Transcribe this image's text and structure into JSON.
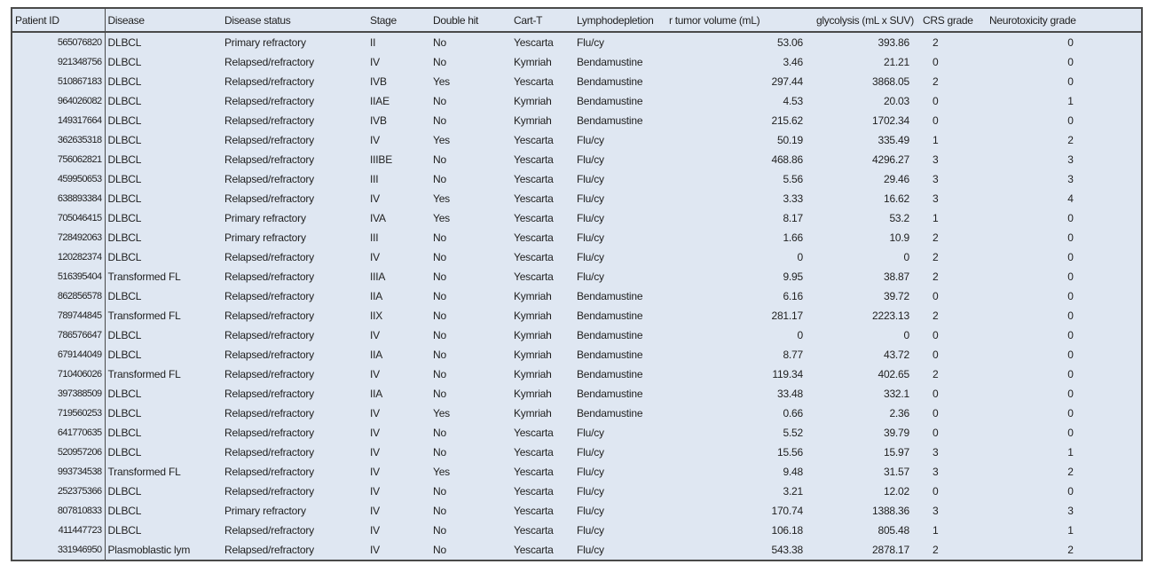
{
  "table": {
    "headers": [
      "Patient ID",
      "Disease",
      "Disease status",
      "Stage",
      "Double hit",
      "Cart-T",
      "Lymphodepletion",
      "r tumor volume (mL)",
      "glycolysis (mL x SUV)",
      "CRS grade",
      "Neurotoxicity grade"
    ],
    "rows": [
      [
        "565076820",
        "DLBCL",
        "Primary refractory",
        "II",
        "No",
        "Yescarta",
        "Flu/cy",
        "53.06",
        "393.86",
        "2",
        "0"
      ],
      [
        "921348756",
        "DLBCL",
        "Relapsed/refractory",
        "IV",
        "No",
        "Kymriah",
        "Bendamustine",
        "3.46",
        "21.21",
        "0",
        "0"
      ],
      [
        "510867183",
        "DLBCL",
        "Relapsed/refractory",
        "IVB",
        "Yes",
        "Yescarta",
        "Bendamustine",
        "297.44",
        "3868.05",
        "2",
        "0"
      ],
      [
        "964026082",
        "DLBCL",
        "Relapsed/refractory",
        "IIAE",
        "No",
        "Kymriah",
        "Bendamustine",
        "4.53",
        "20.03",
        "0",
        "1"
      ],
      [
        "149317664",
        "DLBCL",
        "Relapsed/refractory",
        "IVB",
        "No",
        "Kymriah",
        "Bendamustine",
        "215.62",
        "1702.34",
        "0",
        "0"
      ],
      [
        "362635318",
        "DLBCL",
        "Relapsed/refractory",
        "IV",
        "Yes",
        "Yescarta",
        "Flu/cy",
        "50.19",
        "335.49",
        "1",
        "2"
      ],
      [
        "756062821",
        "DLBCL",
        "Relapsed/refractory",
        "IIIBE",
        "No",
        "Yescarta",
        "Flu/cy",
        "468.86",
        "4296.27",
        "3",
        "3"
      ],
      [
        "459950653",
        "DLBCL",
        "Relapsed/refractory",
        "III",
        "No",
        "Yescarta",
        "Flu/cy",
        "5.56",
        "29.46",
        "3",
        "3"
      ],
      [
        "638893384",
        "DLBCL",
        "Relapsed/refractory",
        "IV",
        "Yes",
        "Yescarta",
        "Flu/cy",
        "3.33",
        "16.62",
        "3",
        "4"
      ],
      [
        "705046415",
        "DLBCL",
        "Primary refractory",
        "IVA",
        "Yes",
        "Yescarta",
        "Flu/cy",
        "8.17",
        "53.2",
        "1",
        "0"
      ],
      [
        "728492063",
        "DLBCL",
        "Primary refractory",
        "III",
        "No",
        "Yescarta",
        "Flu/cy",
        "1.66",
        "10.9",
        "2",
        "0"
      ],
      [
        "120282374",
        "DLBCL",
        "Relapsed/refractory",
        "IV",
        "No",
        "Yescarta",
        "Flu/cy",
        "0",
        "0",
        "2",
        "0"
      ],
      [
        "516395404",
        "Transformed FL",
        "Relapsed/refractory",
        "IIIA",
        "No",
        "Yescarta",
        "Flu/cy",
        "9.95",
        "38.87",
        "2",
        "0"
      ],
      [
        "862856578",
        "DLBCL",
        "Relapsed/refractory",
        "IIA",
        "No",
        "Kymriah",
        "Bendamustine",
        "6.16",
        "39.72",
        "0",
        "0"
      ],
      [
        "789744845",
        "Transformed FL",
        "Relapsed/refractory",
        "IIX",
        "No",
        "Kymriah",
        "Bendamustine",
        "281.17",
        "2223.13",
        "2",
        "0"
      ],
      [
        "786576647",
        "DLBCL",
        "Relapsed/refractory",
        "IV",
        "No",
        "Kymriah",
        "Bendamustine",
        "0",
        "0",
        "0",
        "0"
      ],
      [
        "679144049",
        "DLBCL",
        "Relapsed/refractory",
        "IIA",
        "No",
        "Kymriah",
        "Bendamustine",
        "8.77",
        "43.72",
        "0",
        "0"
      ],
      [
        "710406026",
        "Transformed FL",
        "Relapsed/refractory",
        "IV",
        "No",
        "Kymriah",
        "Bendamustine",
        "119.34",
        "402.65",
        "2",
        "0"
      ],
      [
        "397388509",
        "DLBCL",
        "Relapsed/refractory",
        "IIA",
        "No",
        "Kymriah",
        "Bendamustine",
        "33.48",
        "332.1",
        "0",
        "0"
      ],
      [
        "719560253",
        "DLBCL",
        "Relapsed/refractory",
        "IV",
        "Yes",
        "Kymriah",
        "Bendamustine",
        "0.66",
        "2.36",
        "0",
        "0"
      ],
      [
        "641770635",
        "DLBCL",
        "Relapsed/refractory",
        "IV",
        "No",
        "Yescarta",
        "Flu/cy",
        "5.52",
        "39.79",
        "0",
        "0"
      ],
      [
        "520957206",
        "DLBCL",
        "Relapsed/refractory",
        "IV",
        "No",
        "Yescarta",
        "Flu/cy",
        "15.56",
        "15.97",
        "3",
        "1"
      ],
      [
        "993734538",
        "Transformed FL",
        "Relapsed/refractory",
        "IV",
        "Yes",
        "Yescarta",
        "Flu/cy",
        "9.48",
        "31.57",
        "3",
        "2"
      ],
      [
        "252375366",
        "DLBCL",
        "Relapsed/refractory",
        "IV",
        "No",
        "Yescarta",
        "Flu/cy",
        "3.21",
        "12.02",
        "0",
        "0"
      ],
      [
        "807810833",
        "DLBCL",
        "Primary refractory",
        "IV",
        "No",
        "Yescarta",
        "Flu/cy",
        "170.74",
        "1388.36",
        "3",
        "3"
      ],
      [
        "411447723",
        "DLBCL",
        "Relapsed/refractory",
        "IV",
        "No",
        "Yescarta",
        "Flu/cy",
        "106.18",
        "805.48",
        "1",
        "1"
      ],
      [
        "331946950",
        "Plasmoblastic lym",
        "Relapsed/refractory",
        "IV",
        "No",
        "Yescarta",
        "Flu/cy",
        "543.38",
        "2878.17",
        "2",
        "2"
      ]
    ]
  }
}
